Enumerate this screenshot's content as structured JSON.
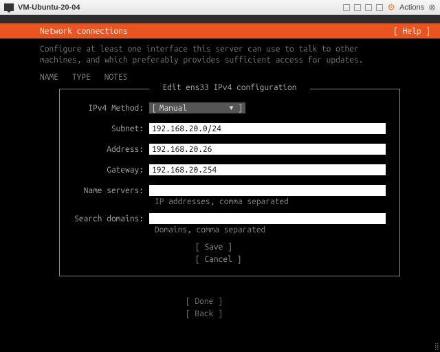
{
  "vm": {
    "title": "VM-Ubuntu-20-04",
    "actions_label": "Actions"
  },
  "header": {
    "title": "Network connections",
    "help": "[ Help ]"
  },
  "instructions": "Configure at least one interface this server can use to talk to other machines, and which preferably provides sufficient access for updates.",
  "columns": {
    "name": "NAME",
    "type": "TYPE",
    "notes": "NOTES"
  },
  "dialog": {
    "title": "Edit ens33 IPv4 configuration",
    "method_label": "IPv4 Method:",
    "method_value": "Manual",
    "subnet_label": "Subnet:",
    "subnet_value": "192.168.20.0/24",
    "address_label": "Address:",
    "address_value": "192.168.20.26",
    "gateway_label": "Gateway:",
    "gateway_value": "192.168.20.254",
    "ns_label": "Name servers:",
    "ns_value": "",
    "ns_hint": "IP addresses, comma separated",
    "sd_label": "Search domains:",
    "sd_value": "",
    "sd_hint": "Domains, comma separated",
    "save": "[ Save     ]",
    "cancel": "[ Cancel   ]"
  },
  "footer": {
    "done": "[ Done     ]",
    "back": "[ Back     ]"
  }
}
